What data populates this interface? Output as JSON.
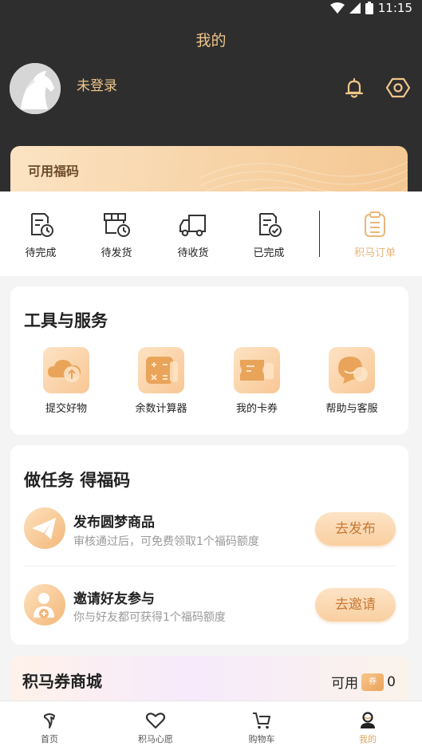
{
  "status_bar": {
    "time": "11:15"
  },
  "header": {
    "title": "我的",
    "login_text": "未登录"
  },
  "fuma_card": {
    "label": "可用福码"
  },
  "orders": [
    {
      "label": "待完成",
      "icon": "pending-doc-icon"
    },
    {
      "label": "待发货",
      "icon": "to-ship-icon"
    },
    {
      "label": "待收货",
      "icon": "delivery-truck-icon"
    },
    {
      "label": "已完成",
      "icon": "completed-doc-icon"
    },
    {
      "label": "积马订单",
      "icon": "clipboard-icon"
    }
  ],
  "tools": {
    "title": "工具与服务",
    "items": [
      {
        "label": "提交好物",
        "icon": "cloud-upload-icon"
      },
      {
        "label": "余数计算器",
        "icon": "calculator-icon"
      },
      {
        "label": "我的卡券",
        "icon": "ticket-icon"
      },
      {
        "label": "帮助与客服",
        "icon": "chat-bubble-icon"
      }
    ]
  },
  "tasks": {
    "title": "做任务 得福码",
    "items": [
      {
        "title": "发布圆梦商品",
        "desc": "审核通过后，可免费领取1个福码额度",
        "button": "去发布",
        "icon": "paper-plane-icon"
      },
      {
        "title": "邀请好友参与",
        "desc": "你与好友都可获得1个福码额度",
        "button": "去邀请",
        "icon": "invite-friend-icon"
      }
    ]
  },
  "mall": {
    "title": "积马券商城",
    "available_label": "可用",
    "coupon_badge": "券",
    "count": "0"
  },
  "tabbar": [
    {
      "label": "首页",
      "icon": "home-horse-icon",
      "active": false
    },
    {
      "label": "积马心愿",
      "icon": "heart-icon",
      "active": false
    },
    {
      "label": "购物车",
      "icon": "cart-icon",
      "active": false
    },
    {
      "label": "我的",
      "icon": "profile-icon",
      "active": true
    }
  ],
  "colors": {
    "header_bg": "#2e2e2e",
    "accent_gold": "#f0c68a",
    "button_text": "#c77a35",
    "active_tab": "#e0a35c"
  }
}
